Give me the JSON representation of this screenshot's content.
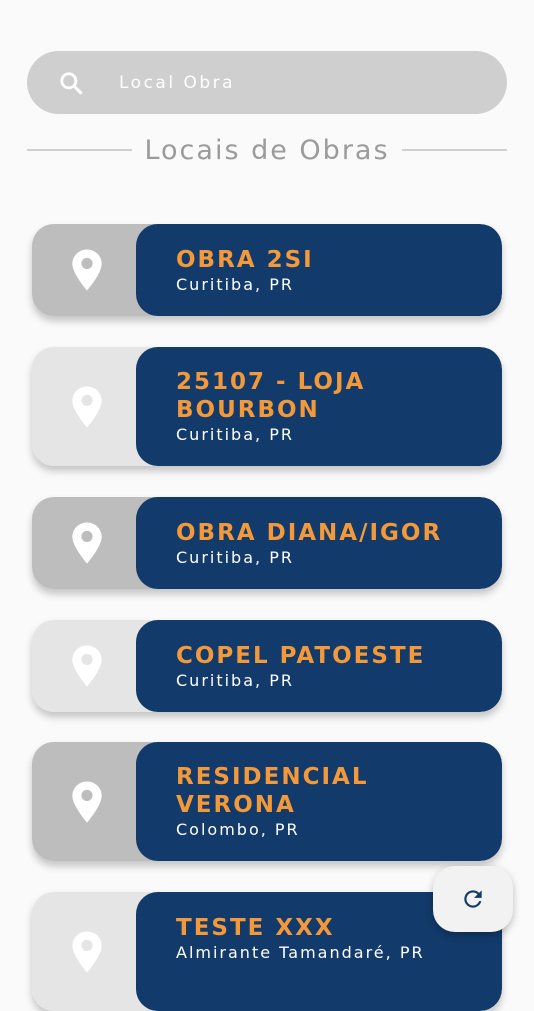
{
  "search": {
    "placeholder": "Local Obra",
    "icon": "search-icon"
  },
  "section": {
    "title": "Locais de Obras"
  },
  "colors": {
    "accent_orange": "#f3993a",
    "card_navy": "#123a6a",
    "pin_area_dark": "#bdbdbd",
    "pin_area_light": "#e5e5e5"
  },
  "obras": [
    {
      "name": "OBRA 2SI",
      "city": "Curitiba, PR"
    },
    {
      "name": "25107 - LOJA BOURBON",
      "city": "Curitiba, PR"
    },
    {
      "name": "OBRA DIANA/IGOR",
      "city": "Curitiba, PR"
    },
    {
      "name": "COPEL PATOESTE",
      "city": "Curitiba, PR"
    },
    {
      "name": "RESIDENCIAL VERONA",
      "city": "Colombo, PR"
    },
    {
      "name": "TESTE xxx",
      "city": "Almirante Tamandaré, PR"
    }
  ],
  "fab": {
    "icon": "refresh-icon"
  }
}
